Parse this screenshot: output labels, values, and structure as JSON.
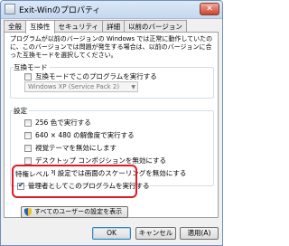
{
  "window": {
    "title": "Exit-Winのプロパティ",
    "close_glyph": "✕"
  },
  "tabs": [
    {
      "label": "全般"
    },
    {
      "label": "互換性"
    },
    {
      "label": "セキュリティ"
    },
    {
      "label": "詳細"
    },
    {
      "label": "以前のバージョン"
    }
  ],
  "description": "プログラムが以前のバージョンの Windows では正常に動作していたのに、このバージョンでは問題が発生する場合は、以前のバージョンに合った互換モードを選択してください。",
  "compat_mode": {
    "label": "互換モード",
    "checkbox_label": "互換モードでこのプログラムを実行する",
    "checked": false,
    "select_value": "Windows XP (Service Pack 2)"
  },
  "settings": {
    "label": "設定",
    "options": [
      {
        "label": "256 色で実行する",
        "checked": false
      },
      {
        "label": "640 × 480 の解像度で実行する",
        "checked": false
      },
      {
        "label": "視覚テーマを無効にします",
        "checked": false
      },
      {
        "label": "デスクトップ コンポジションを無効にする",
        "checked": false
      },
      {
        "label": "高 DPI 設定では画面のスケーリングを無効にする",
        "checked": false
      }
    ]
  },
  "privilege": {
    "label": "特権レベル",
    "checkbox_label": "管理者としてこのプログラムを実行する",
    "checked": true
  },
  "all_users_button": "すべてのユーザーの設定を表示",
  "buttons": {
    "ok": "OK",
    "cancel": "キャンセル",
    "apply": "適用(A)"
  },
  "colors": {
    "highlight": "#e0182a",
    "title_bar": "#c4d8ef"
  }
}
